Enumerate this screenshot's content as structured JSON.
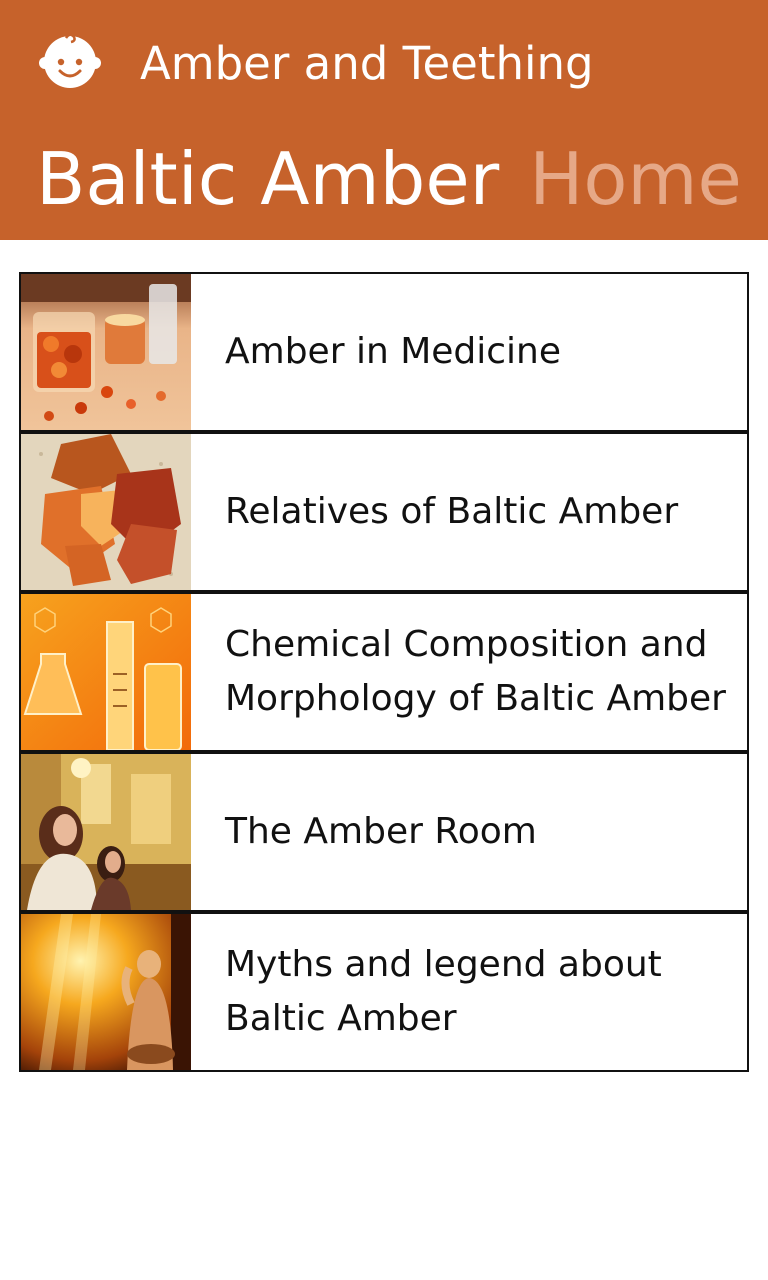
{
  "app": {
    "title": "Amber and Teething",
    "icon": "baby-face-icon"
  },
  "pivot": {
    "active": "Baltic Amber",
    "inactive": "Home"
  },
  "colors": {
    "accent": "#c6622b",
    "pivot_inactive": "#e6a887"
  },
  "items": [
    {
      "label": "Amber in Medicine",
      "thumb": "amber-glass-candle-image"
    },
    {
      "label": "Relatives of Baltic Amber",
      "thumb": "raw-amber-stones-image"
    },
    {
      "label": "Chemical Composition and Morphology of Baltic Amber",
      "thumb": "lab-glassware-image"
    },
    {
      "label": "The Amber Room",
      "thumb": "amber-room-visitors-image"
    },
    {
      "label": "Myths and legend about Baltic Amber",
      "thumb": "golden-statue-light-image"
    }
  ]
}
